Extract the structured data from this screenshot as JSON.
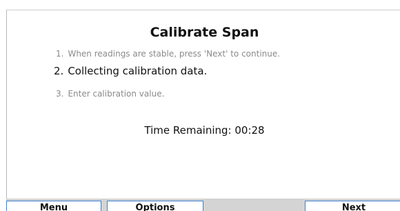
{
  "screen": {
    "title": "Calibrate Span",
    "steps": [
      {
        "number": "1.",
        "text": "When readings are stable, press 'Next' to continue.",
        "state": "inactive"
      },
      {
        "number": "2.",
        "text": "Collecting calibration data.",
        "state": "active"
      },
      {
        "number": "3.",
        "text": "Enter calibration value.",
        "state": "inactive"
      }
    ],
    "time_remaining": "Time Remaining: 00:28"
  },
  "softkeys": {
    "menu_label": "Menu",
    "options_label": "Options",
    "next_label": "Next"
  },
  "colors": {
    "button_border": "#3a7fd0",
    "bar_background": "#d4d4d4",
    "inactive_text": "#8a8a8a"
  }
}
